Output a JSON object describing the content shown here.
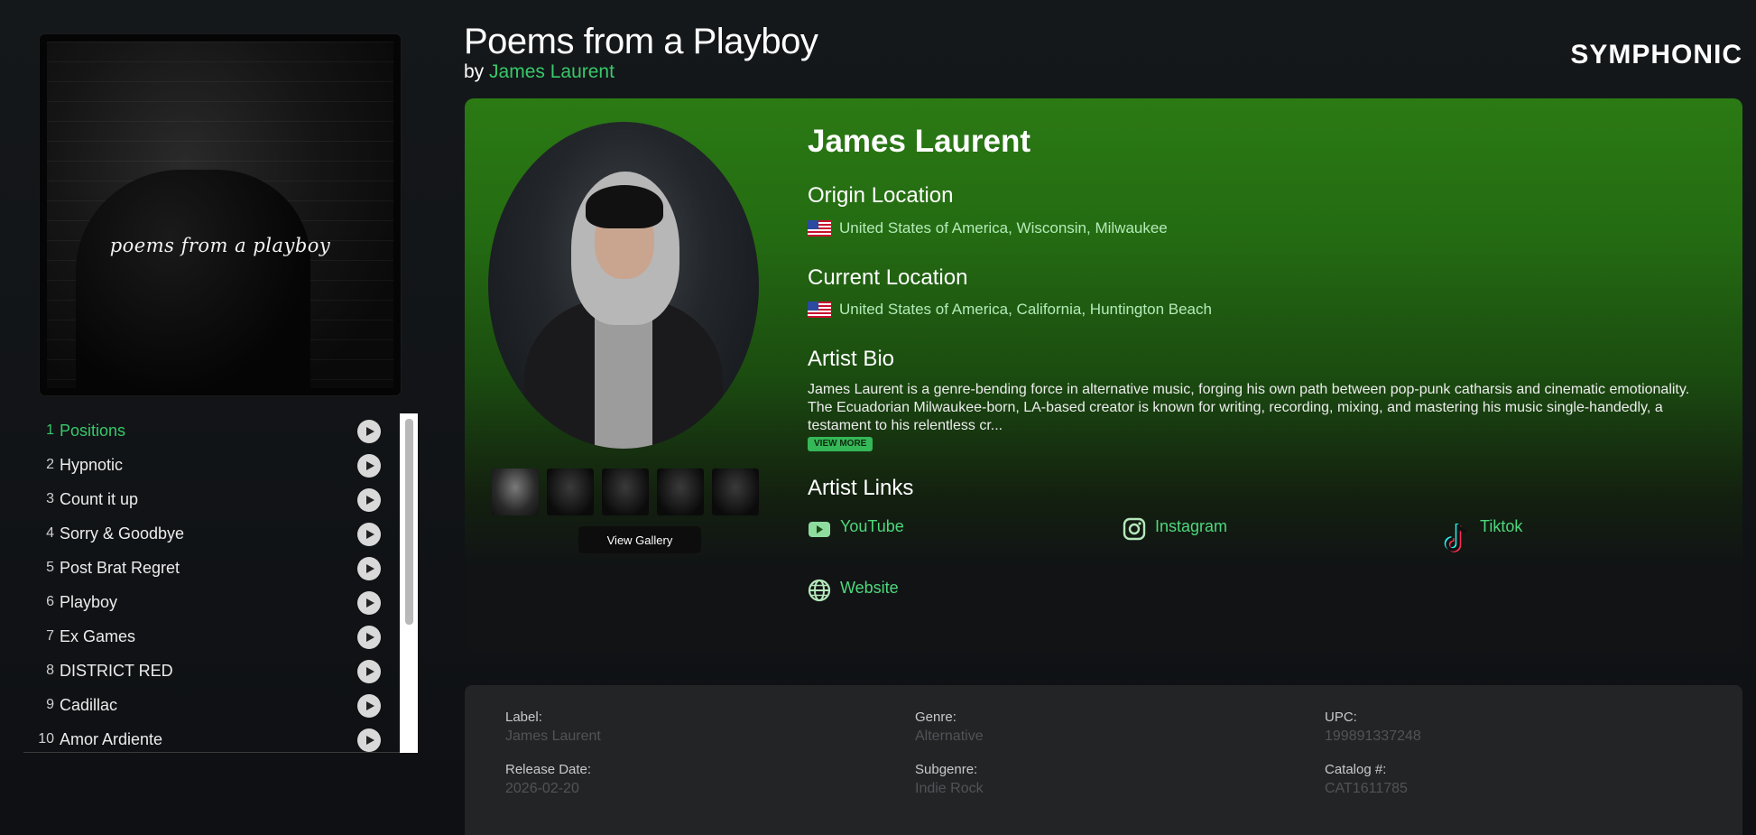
{
  "album": {
    "title": "Poems from a Playboy",
    "by_prefix": "by",
    "artist": "James Laurent",
    "cover_text": "poems from a playboy"
  },
  "brand": "SYMPHONIC",
  "tracks": [
    {
      "num": "1",
      "title": "Positions",
      "active": true
    },
    {
      "num": "2",
      "title": "Hypnotic"
    },
    {
      "num": "3",
      "title": "Count it up"
    },
    {
      "num": "4",
      "title": "Sorry & Goodbye"
    },
    {
      "num": "5",
      "title": "Post Brat Regret"
    },
    {
      "num": "6",
      "title": "Playboy"
    },
    {
      "num": "7",
      "title": "Ex Games"
    },
    {
      "num": "8",
      "title": "DISTRICT RED"
    },
    {
      "num": "9",
      "title": "Cadillac"
    },
    {
      "num": "10",
      "title": "Amor Ardiente"
    }
  ],
  "artist": {
    "name": "James Laurent",
    "origin_heading": "Origin Location",
    "origin": "United States of America,  Wisconsin, Milwaukee",
    "current_heading": "Current Location",
    "current": "United States of America,  California, Huntington Beach",
    "bio_heading": "Artist Bio",
    "bio": "James Laurent is a genre-bending force in alternative music, forging his own path between pop-punk catharsis and cinematic emotionality. The Ecuadorian Milwaukee-born, LA-based creator is known for writing, recording, mixing, and mastering his music single-handedly, a testament to his relentless cr...",
    "view_more": "VIEW MORE",
    "links_heading": "Artist Links",
    "links": {
      "youtube": "YouTube",
      "instagram": "Instagram",
      "tiktok": "Tiktok",
      "website": "Website"
    },
    "gallery_button": "View Gallery"
  },
  "meta": {
    "label_label": "Label:",
    "label_value": "James Laurent",
    "genre_label": "Genre:",
    "genre_value": "Alternative",
    "upc_label": "UPC:",
    "upc_value": "199891337248",
    "release_label": "Release Date:",
    "release_value": "2026-02-20",
    "subgenre_label": "Subgenre:",
    "subgenre_value": "Indie Rock",
    "catalog_label": "Catalog #:",
    "catalog_value": "CAT1611785"
  },
  "colors": {
    "accent": "#38c96a",
    "card_top": "#2b7a14",
    "background": "#15181b"
  }
}
